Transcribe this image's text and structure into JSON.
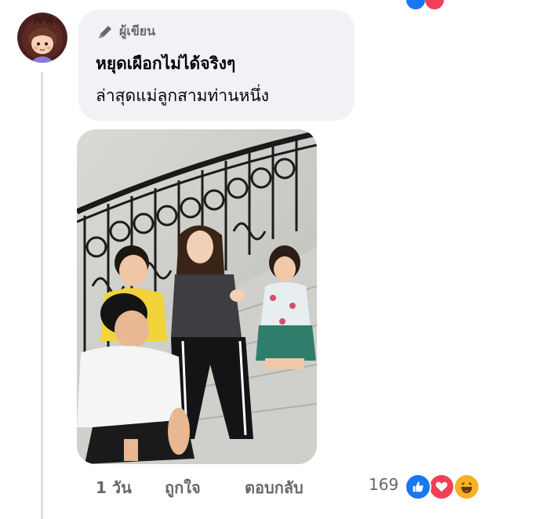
{
  "comment": {
    "author_badge": "ผู้เขียน",
    "line1": "หยุดเผือกไม่ได้จริงๆ",
    "line2": "ล่าสุดแม่ลูกสามท่านหนึ่ง"
  },
  "actions": {
    "time": "1 วัน",
    "like": "ถูกใจ",
    "reply": "ตอบกลับ",
    "reaction_count": "169"
  },
  "reactions": [
    "like-icon",
    "love-icon",
    "haha-icon"
  ],
  "colors": {
    "bubble_bg": "#f0f2f5",
    "meta_text": "#65676b",
    "like_blue": "#1877f2",
    "love_red": "#f33e58",
    "haha_yellow": "#f7b125"
  }
}
